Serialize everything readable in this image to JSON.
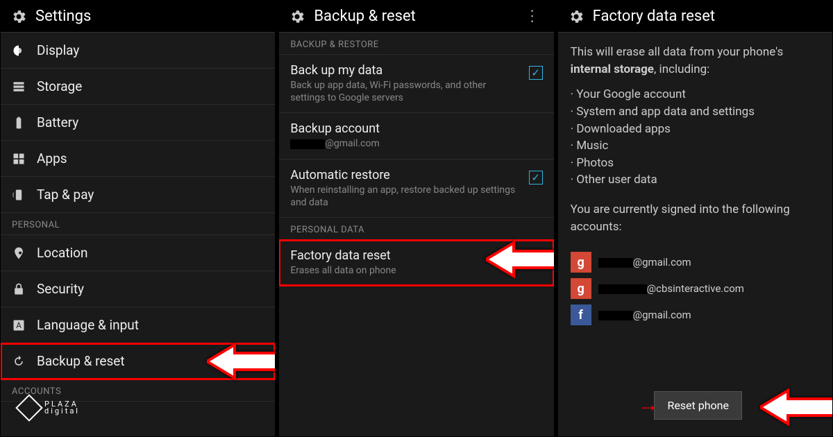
{
  "watermark": {
    "line1": "PLAZA",
    "line2": "digital"
  },
  "panel1": {
    "title": "Settings",
    "items": [
      {
        "icon": "display",
        "label": "Display"
      },
      {
        "icon": "storage",
        "label": "Storage"
      },
      {
        "icon": "battery",
        "label": "Battery"
      },
      {
        "icon": "apps",
        "label": "Apps"
      },
      {
        "icon": "nfc",
        "label": "Tap & pay"
      }
    ],
    "section_personal": "PERSONAL",
    "personal_items": [
      {
        "icon": "location",
        "label": "Location"
      },
      {
        "icon": "security",
        "label": "Security"
      },
      {
        "icon": "language",
        "label": "Language & input"
      },
      {
        "icon": "backup",
        "label": "Backup & reset",
        "highlight": true
      }
    ],
    "section_accounts": "ACCOUNTS"
  },
  "panel2": {
    "title": "Backup & reset",
    "section_backup": "BACKUP & RESTORE",
    "backup_data": {
      "title": "Back up my data",
      "sub": "Back up app data, Wi-Fi passwords, and other settings to Google servers",
      "checked": true
    },
    "backup_account": {
      "title": "Backup account",
      "sub": "@gmail.com"
    },
    "auto_restore": {
      "title": "Automatic restore",
      "sub": "When reinstalling an app, restore backed up settings and data",
      "checked": true
    },
    "section_personal": "PERSONAL DATA",
    "factory_reset": {
      "title": "Factory data reset",
      "sub": "Erases all data on phone"
    }
  },
  "panel3": {
    "title": "Factory data reset",
    "intro_a": "This will erase all data from your phone's ",
    "intro_bold": "internal storage",
    "intro_b": ", including:",
    "bullets": [
      "Your Google account",
      "System and app data and settings",
      "Downloaded apps",
      "Music",
      "Photos",
      "Other user data"
    ],
    "signed_in": "You are currently signed into the following accounts:",
    "accounts": [
      {
        "type": "google",
        "email": "@gmail.com"
      },
      {
        "type": "google",
        "email": "@cbsinteractive.com"
      },
      {
        "type": "facebook",
        "email": "@gmail.com"
      }
    ],
    "reset_btn": "Reset phone"
  }
}
